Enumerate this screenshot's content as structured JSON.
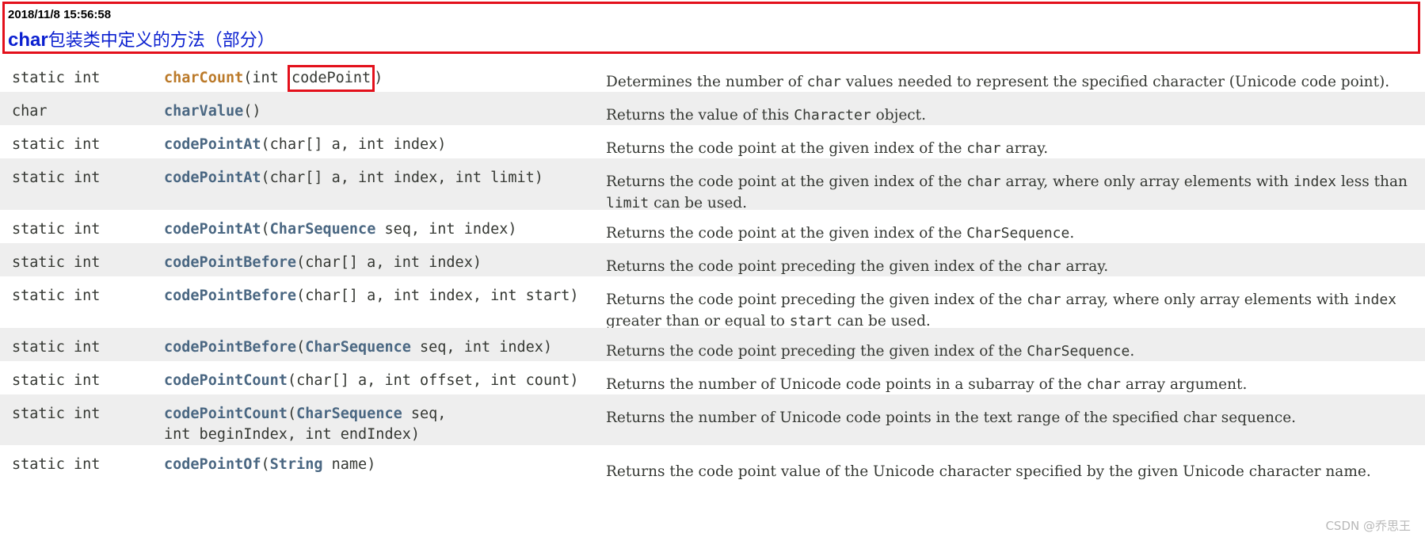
{
  "note": {
    "timestamp": "2018/11/8 15:56:58",
    "title_word": "char",
    "title_rest": "包装类中定义的方法（部分）"
  },
  "rows": [
    {
      "modifier": "static int",
      "method": "charCount",
      "params_open": "(int ",
      "boxed_param": "codePoint",
      "params_close": ")",
      "desc_parts": [
        "Determines the number of ",
        "char",
        " values needed to represent the specified character (Unicode code point)."
      ]
    },
    {
      "modifier": "char",
      "method": "charValue",
      "params": "()",
      "desc_parts": [
        "Returns the value of this ",
        "Character",
        " object."
      ]
    },
    {
      "modifier": "static int",
      "method": "codePointAt",
      "params": "(char[] a, int index)",
      "desc_parts": [
        "Returns the code point at the given index of the ",
        "char",
        " array."
      ]
    },
    {
      "modifier": "static int",
      "method": "codePointAt",
      "params": "(char[] a, int index, int limit)",
      "desc_parts": [
        "Returns the code point at the given index of the ",
        "char",
        " array, where only array elements with ",
        "index",
        " less than ",
        "limit",
        " can be used."
      ]
    },
    {
      "modifier": "static int",
      "method": "codePointAt",
      "params_open": "(",
      "type_link": "CharSequence",
      "params_close": " seq, int index)",
      "desc_parts": [
        "Returns the code point at the given index of the ",
        "CharSequence",
        "."
      ]
    },
    {
      "modifier": "static int",
      "method": "codePointBefore",
      "params": "(char[] a, int index)",
      "desc_parts": [
        "Returns the code point preceding the given index of the ",
        "char",
        " array."
      ]
    },
    {
      "modifier": "static int",
      "method": "codePointBefore",
      "params": "(char[] a, int index, int start)",
      "desc_parts": [
        "Returns the code point preceding the given index of the ",
        "char",
        " array, where only array elements with ",
        "index",
        " greater than or equal to ",
        "start",
        " can be used."
      ]
    },
    {
      "modifier": "static int",
      "method": "codePointBefore",
      "params_open": "(",
      "type_link": "CharSequence",
      "params_close": " seq, int index)",
      "desc_parts": [
        "Returns the code point preceding the given index of the ",
        "CharSequence",
        "."
      ]
    },
    {
      "modifier": "static int",
      "method": "codePointCount",
      "params": "(char[] a, int offset, int count)",
      "desc_parts": [
        "Returns the number of Unicode code points in a subarray of the ",
        "char",
        " array argument."
      ]
    },
    {
      "modifier": "static int",
      "method": "codePointCount",
      "params_open": "(",
      "type_link": "CharSequence",
      "params_close": " seq,",
      "params_line2": "int beginIndex, int endIndex)",
      "desc_parts": [
        "Returns the number of Unicode code points in the text range of the specified char sequence."
      ]
    },
    {
      "modifier": "static int",
      "method": "codePointOf",
      "params_open": "(",
      "type_link": "String",
      "params_close": " name)",
      "desc_parts": [
        "Returns the code point value of the Unicode character specified by the given Unicode character name."
      ]
    }
  ],
  "watermark": "CSDN @乔思王"
}
